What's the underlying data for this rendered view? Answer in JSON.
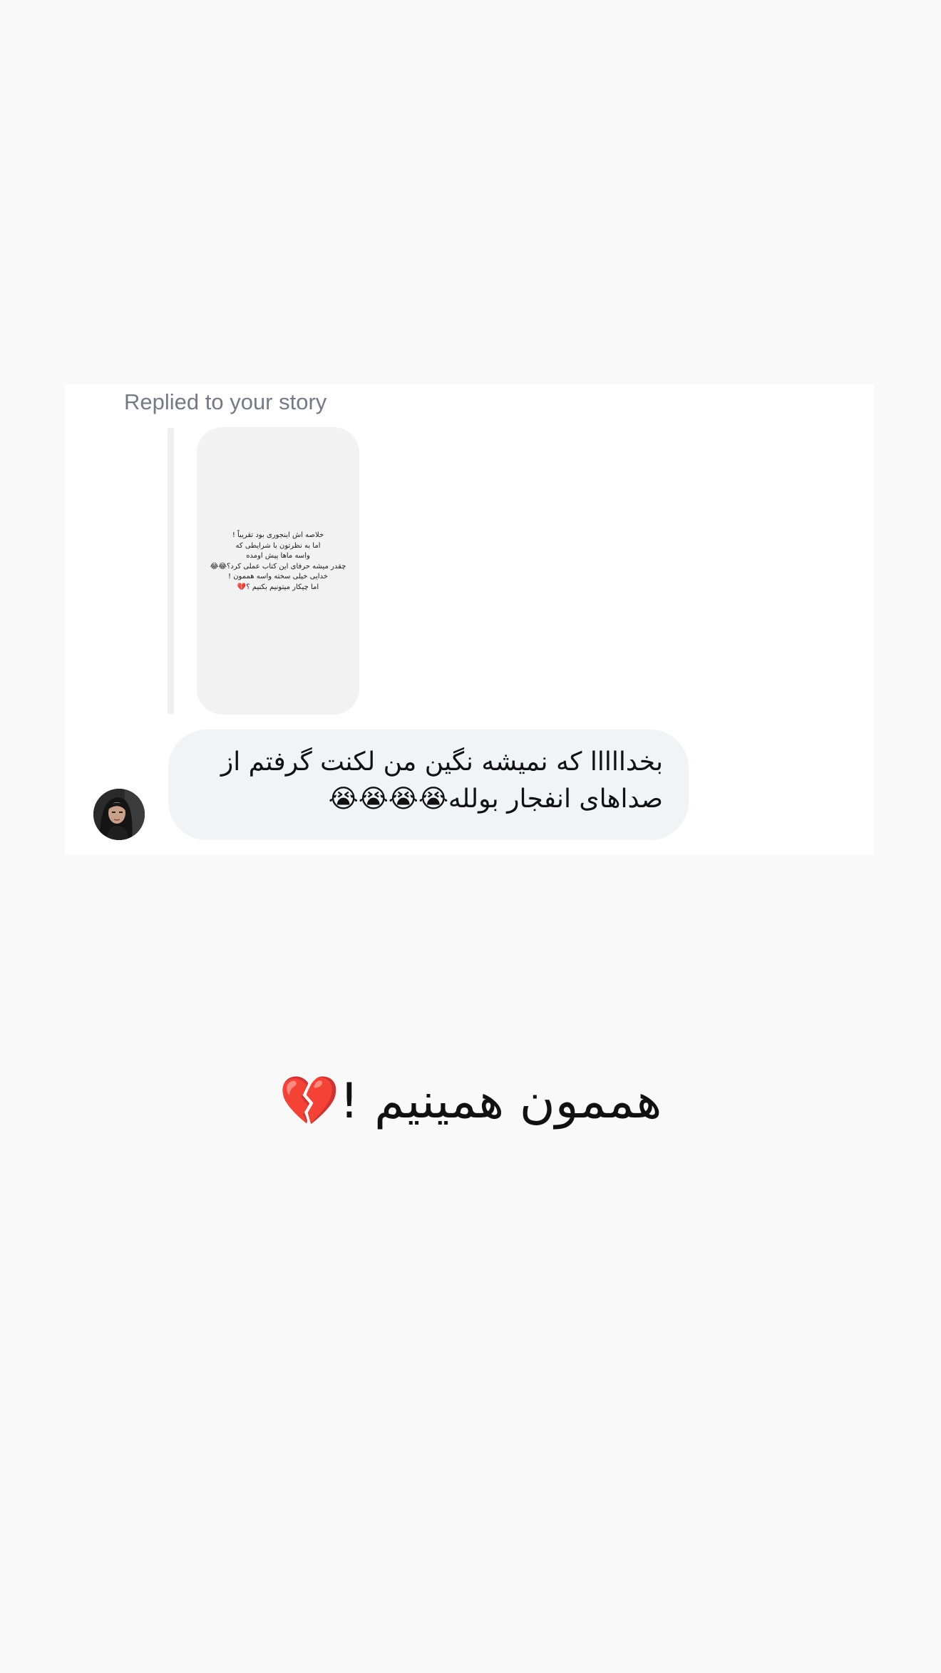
{
  "dm": {
    "reply_label": "Replied to your story",
    "story_lines": [
      "خلاصه اش اینجوری بود تقریباً !",
      "اما به نظرتون با شرایطی که",
      "واسه ماها پیش اومده",
      "چقدر میشه حرفای این کتاب عملی کرد؟😂😂",
      "خدایی خیلی سخته واسه هممون !",
      "اما چیکار میتونیم بکنیم ؟💔"
    ],
    "message_lines": [
      "بخدااااا که نمیشه نگین من لکنت گرفتم از",
      "صداهای انفجار بولله😭😭😭😭"
    ]
  },
  "caption": "هممون همینیم !💔",
  "colors": {
    "page_background": "#f9f9f9",
    "card_background": "#ffffff",
    "bubble_background": "#f2f3f5",
    "reply_label": "#737a85",
    "story_thumb_background": "#f2f2f2"
  }
}
